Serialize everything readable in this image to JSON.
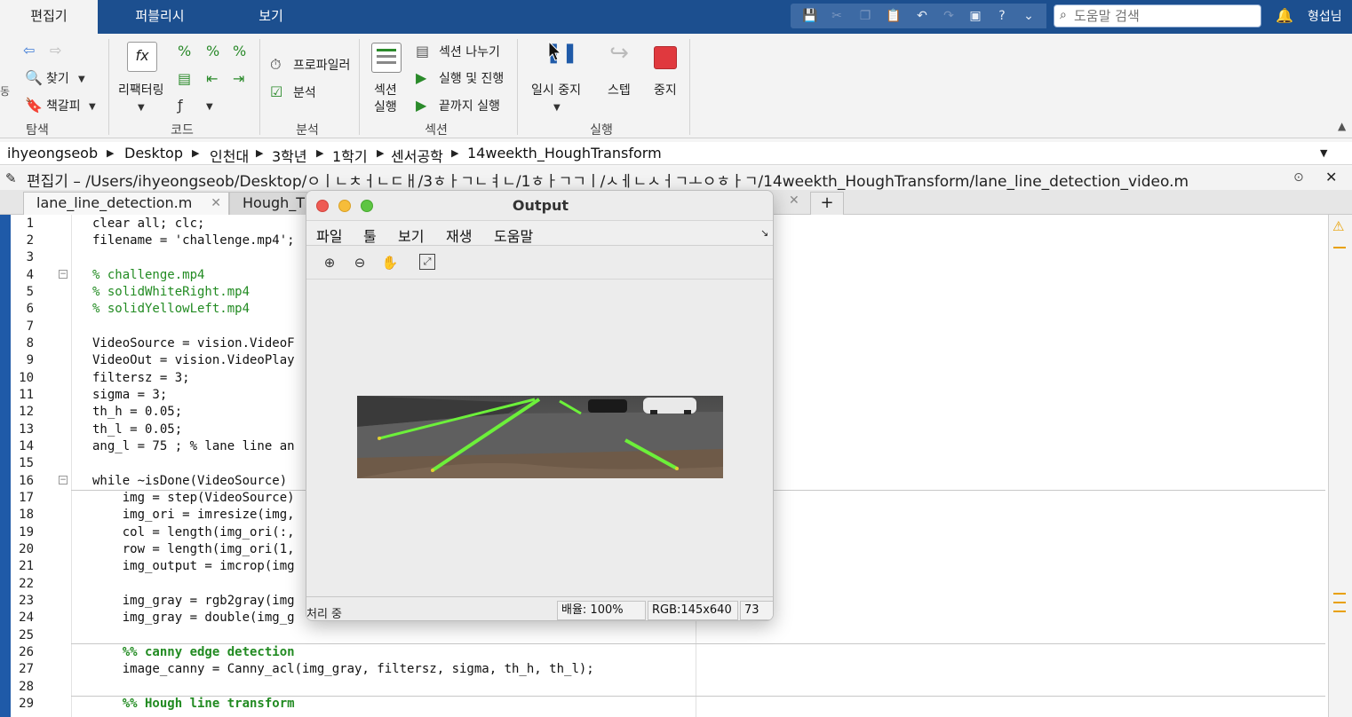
{
  "tabs": [
    {
      "label": "편집기"
    },
    {
      "label": "퍼블리시"
    },
    {
      "label": "보기"
    }
  ],
  "search": {
    "placeholder": "도움말 검색"
  },
  "user": {
    "name": "형섭님"
  },
  "ribbon": {
    "navigate": {
      "find": "찾기",
      "bookmark": "책갈피",
      "group": "탐색",
      "partial_label": "동"
    },
    "code": {
      "refactor": "리팩터링",
      "group": "코드"
    },
    "analyze": {
      "profiler": "프로파일러",
      "analyze": "분석",
      "group": "분석"
    },
    "section": {
      "run_section_line1": "섹션",
      "run_section_line2": "실행",
      "split": "섹션 나누기",
      "run_advance": "실행 및 진행",
      "run_to_end": "끝까지 실행",
      "group": "섹션"
    },
    "run": {
      "pause": "일시 중지",
      "step": "스텝",
      "stop": "중지",
      "group": "실행"
    }
  },
  "breadcrumb": [
    "ihyeongseob",
    "Desktop",
    "인천대",
    "3학년",
    "1학기",
    "센서공학",
    "14weekth_HoughTransform"
  ],
  "editor": {
    "title": "편집기 – /Users/ihyeongseob/Desktop/ㅇㅣㄴㅊㅓㄴㄷㅐ/3ㅎㅏㄱㄴㅕㄴ/1ㅎㅏㄱㄱㅣ/ㅅㅔㄴㅅㅓㄱㅗㅇㅎㅏㄱ/14weekth_HoughTransform/lane_line_detection_video.m",
    "tabs": [
      {
        "label": "lane_line_detection.m"
      },
      {
        "label": "Hough_T"
      }
    ],
    "lines": [
      {
        "n": "1",
        "text": "clear all; clc;"
      },
      {
        "n": "2",
        "text": "filename = 'challenge.mp4';"
      },
      {
        "n": "3",
        "text": ""
      },
      {
        "n": "4",
        "text": "% challenge.mp4"
      },
      {
        "n": "5",
        "text": "% solidWhiteRight.mp4"
      },
      {
        "n": "6",
        "text": "% solidYellowLeft.mp4"
      },
      {
        "n": "7",
        "text": ""
      },
      {
        "n": "8",
        "text": "VideoSource = vision.VideoF"
      },
      {
        "n": "9",
        "text": "VideoOut = vision.VideoPlay"
      },
      {
        "n": "10",
        "text": "filtersz = 3;"
      },
      {
        "n": "11",
        "text": "sigma = 3;"
      },
      {
        "n": "12",
        "text": "th_h = 0.05;"
      },
      {
        "n": "13",
        "text": "th_l = 0.05;"
      },
      {
        "n": "14",
        "text": "ang_l = 75 ; % lane line an"
      },
      {
        "n": "15",
        "text": ""
      },
      {
        "n": "16",
        "text": "while ~isDone(VideoSource)"
      },
      {
        "n": "17",
        "text": "    img = step(VideoSource)"
      },
      {
        "n": "18",
        "text": "    img_ori = imresize(img,"
      },
      {
        "n": "19",
        "text": "    col = length(img_ori(:,"
      },
      {
        "n": "20",
        "text": "    row = length(img_ori(1,"
      },
      {
        "n": "21",
        "text": "    img_output = imcrop(img"
      },
      {
        "n": "22",
        "text": ""
      },
      {
        "n": "23",
        "text": "    img_gray = rgb2gray(img"
      },
      {
        "n": "24",
        "text": "    img_gray = double(img_g"
      },
      {
        "n": "25",
        "text": ""
      },
      {
        "n": "26",
        "text": "    %% canny edge detection"
      },
      {
        "n": "27",
        "text": "    image_canny = Canny_acl(img_gray, filtersz, sigma, th_h, th_l);"
      },
      {
        "n": "28",
        "text": ""
      },
      {
        "n": "29",
        "text": "    %% Hough line transform"
      }
    ]
  },
  "output_window": {
    "title": "Output",
    "menu": [
      "파일",
      "툴",
      "보기",
      "재생",
      "도움말"
    ],
    "status": {
      "state": "처리 중",
      "zoom": "배율: 100%",
      "rgb": "RGB:145x640",
      "frame": "73"
    }
  },
  "colors": {
    "tab_strip": "#1c4f8f",
    "stop_red": "#e0393e",
    "lane_green": "#6cf03a"
  },
  "icons": [
    "save-icon",
    "cut-icon",
    "copy-icon",
    "paste-icon",
    "undo-icon",
    "redo-icon",
    "window-icon",
    "help-icon",
    "dropdown-icon",
    "search-icon",
    "bell-icon"
  ]
}
